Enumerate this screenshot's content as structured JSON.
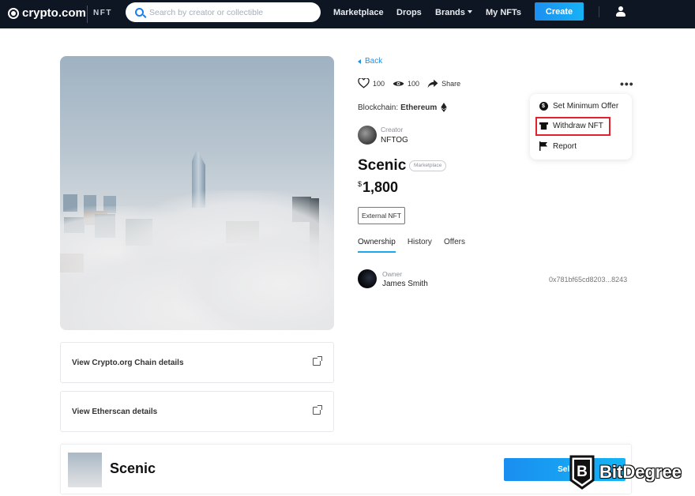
{
  "topbar": {
    "brand": "crypto.com",
    "section": "NFT",
    "search_placeholder": "Search by creator or collectible",
    "nav": [
      "Marketplace",
      "Drops",
      "Brands",
      "My NFTs"
    ],
    "create_label": "Create"
  },
  "media": {
    "image_alt": "Skyscrapers above clouds",
    "details_links": [
      "View Crypto.org Chain details",
      "View Etherscan details"
    ]
  },
  "info": {
    "back_label": "Back",
    "likes": "100",
    "views": "100",
    "share_label": "Share",
    "blockchain_label": "Blockchain:",
    "blockchain_value": "Ethereum",
    "creator_label": "Creator",
    "creator_name": "NFTOG",
    "title": "Scenic",
    "badge": "Marketplace",
    "price_currency": "$",
    "price": "1,800",
    "external_tag": "External NFT",
    "tabs": [
      "Ownership",
      "History",
      "Offers"
    ],
    "active_tab": "Ownership",
    "owner_label": "Owner",
    "owner_name": "James Smith",
    "owner_address": "0x781bf65cd8203...8243"
  },
  "menu": {
    "items": [
      "Set Minimum Offer",
      "Withdraw NFT",
      "Report"
    ],
    "highlighted": "Withdraw NFT"
  },
  "bottom_bar": {
    "title": "Scenic",
    "sell_label": "Sell"
  },
  "watermark": "BitDegree",
  "colors": {
    "topbar_bg": "#0f1623",
    "accent": "#1a91e8",
    "highlight": "#e1212b"
  }
}
